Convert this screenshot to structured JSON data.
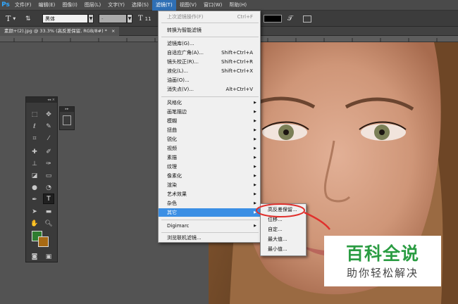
{
  "app": {
    "logo": "Ps"
  },
  "menubar": {
    "items": [
      "文件(F)",
      "编辑(E)",
      "图像(I)",
      "图层(L)",
      "文字(Y)",
      "选择(S)",
      "滤镜(T)",
      "视图(V)",
      "窗口(W)",
      "帮助(H)"
    ],
    "active_index": 6
  },
  "options": {
    "tool_glyph": "T",
    "font_family": "黑体",
    "font_style": "-",
    "font_size": "11"
  },
  "document_tab": {
    "title": "素颜+(2).jpg @ 33.3% (高反差保留, RGB/8#) *",
    "close": "×"
  },
  "filter_menu": {
    "items": [
      {
        "label": "上次滤镜操作(F)",
        "shortcut": "Ctrl+F",
        "disabled": true
      },
      {
        "label": "转换为智能滤镜",
        "shortcut": ""
      },
      {
        "label": "滤镜库(G)...",
        "shortcut": ""
      },
      {
        "label": "自适应广角(A)...",
        "shortcut": "Shift+Ctrl+A"
      },
      {
        "label": "镜头校正(R)...",
        "shortcut": "Shift+Ctrl+R"
      },
      {
        "label": "液化(L)...",
        "shortcut": "Shift+Ctrl+X"
      },
      {
        "label": "油画(O)...",
        "shortcut": ""
      },
      {
        "label": "消失点(V)...",
        "shortcut": "Alt+Ctrl+V"
      },
      {
        "label": "风格化",
        "submenu": true
      },
      {
        "label": "画笔描边",
        "submenu": true
      },
      {
        "label": "模糊",
        "submenu": true
      },
      {
        "label": "扭曲",
        "submenu": true
      },
      {
        "label": "锐化",
        "submenu": true
      },
      {
        "label": "视频",
        "submenu": true
      },
      {
        "label": "素描",
        "submenu": true
      },
      {
        "label": "纹理",
        "submenu": true
      },
      {
        "label": "像素化",
        "submenu": true
      },
      {
        "label": "渲染",
        "submenu": true
      },
      {
        "label": "艺术效果",
        "submenu": true
      },
      {
        "label": "杂色",
        "submenu": true
      },
      {
        "label": "其它",
        "submenu": true,
        "highlighted": true
      },
      {
        "label": "Digimarc",
        "submenu": true
      },
      {
        "label": "浏览联机滤镜...",
        "shortcut": ""
      }
    ]
  },
  "other_submenu": {
    "items": [
      "高反差保留...",
      "位移...",
      "自定...",
      "最大值...",
      "最小值..."
    ],
    "circled_index": 0,
    "circle_color": "#e0302c"
  },
  "watermark": {
    "title": "百科全说",
    "subtitle": "助你轻松解决",
    "title_color": "#2a9c42"
  },
  "tools": {
    "foreground_color": "#2f7d2f",
    "background_color": "#a86a14"
  }
}
